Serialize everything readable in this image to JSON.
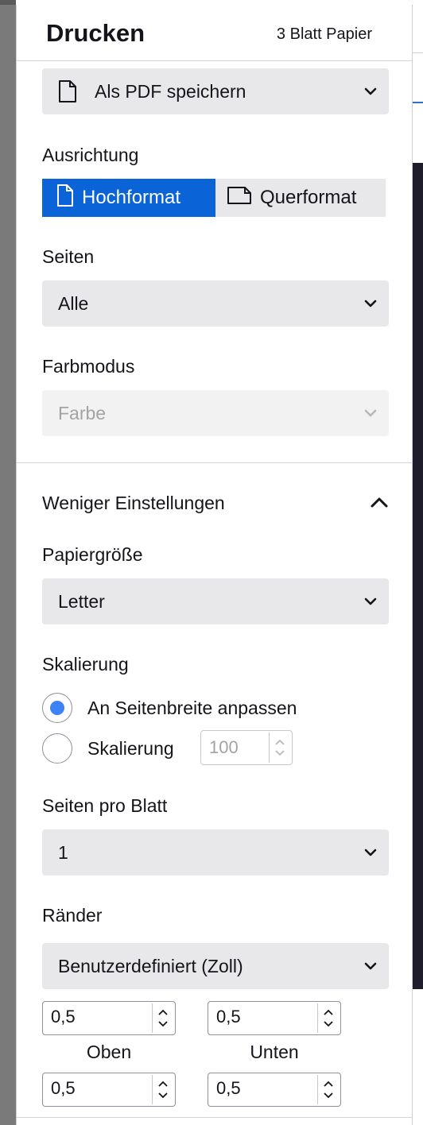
{
  "header": {
    "title": "Drucken",
    "sheet_count": "3 Blatt Papier"
  },
  "destination": {
    "value": "Als PDF speichern",
    "icon": "document-icon"
  },
  "orientation": {
    "label": "Ausrichtung",
    "portrait_label": "Hochformat",
    "landscape_label": "Querformat",
    "selected": "Hochformat",
    "accent_color": "#0b63d8"
  },
  "pages": {
    "label": "Seiten",
    "value": "Alle"
  },
  "color_mode": {
    "label": "Farbmodus",
    "value": "Farbe",
    "disabled": true
  },
  "more_settings": {
    "label": "Weniger Einstellungen",
    "expanded": true
  },
  "paper_size": {
    "label": "Papiergröße",
    "value": "Letter"
  },
  "scaling": {
    "label": "Skalierung",
    "option_fit": "An Seitenbreite anpassen",
    "option_scale": "Skalierung",
    "selected": "An Seitenbreite anpassen",
    "scale_value": "100"
  },
  "pages_per_sheet": {
    "label": "Seiten pro Blatt",
    "value": "1"
  },
  "margins": {
    "label": "Ränder",
    "value": "Benutzerdefiniert (Zoll)",
    "top_value": "0,5",
    "top_label": "Oben",
    "bottom_value": "0,5",
    "bottom_label": "Unten",
    "left_value": "0,5",
    "right_value": "0,5"
  }
}
